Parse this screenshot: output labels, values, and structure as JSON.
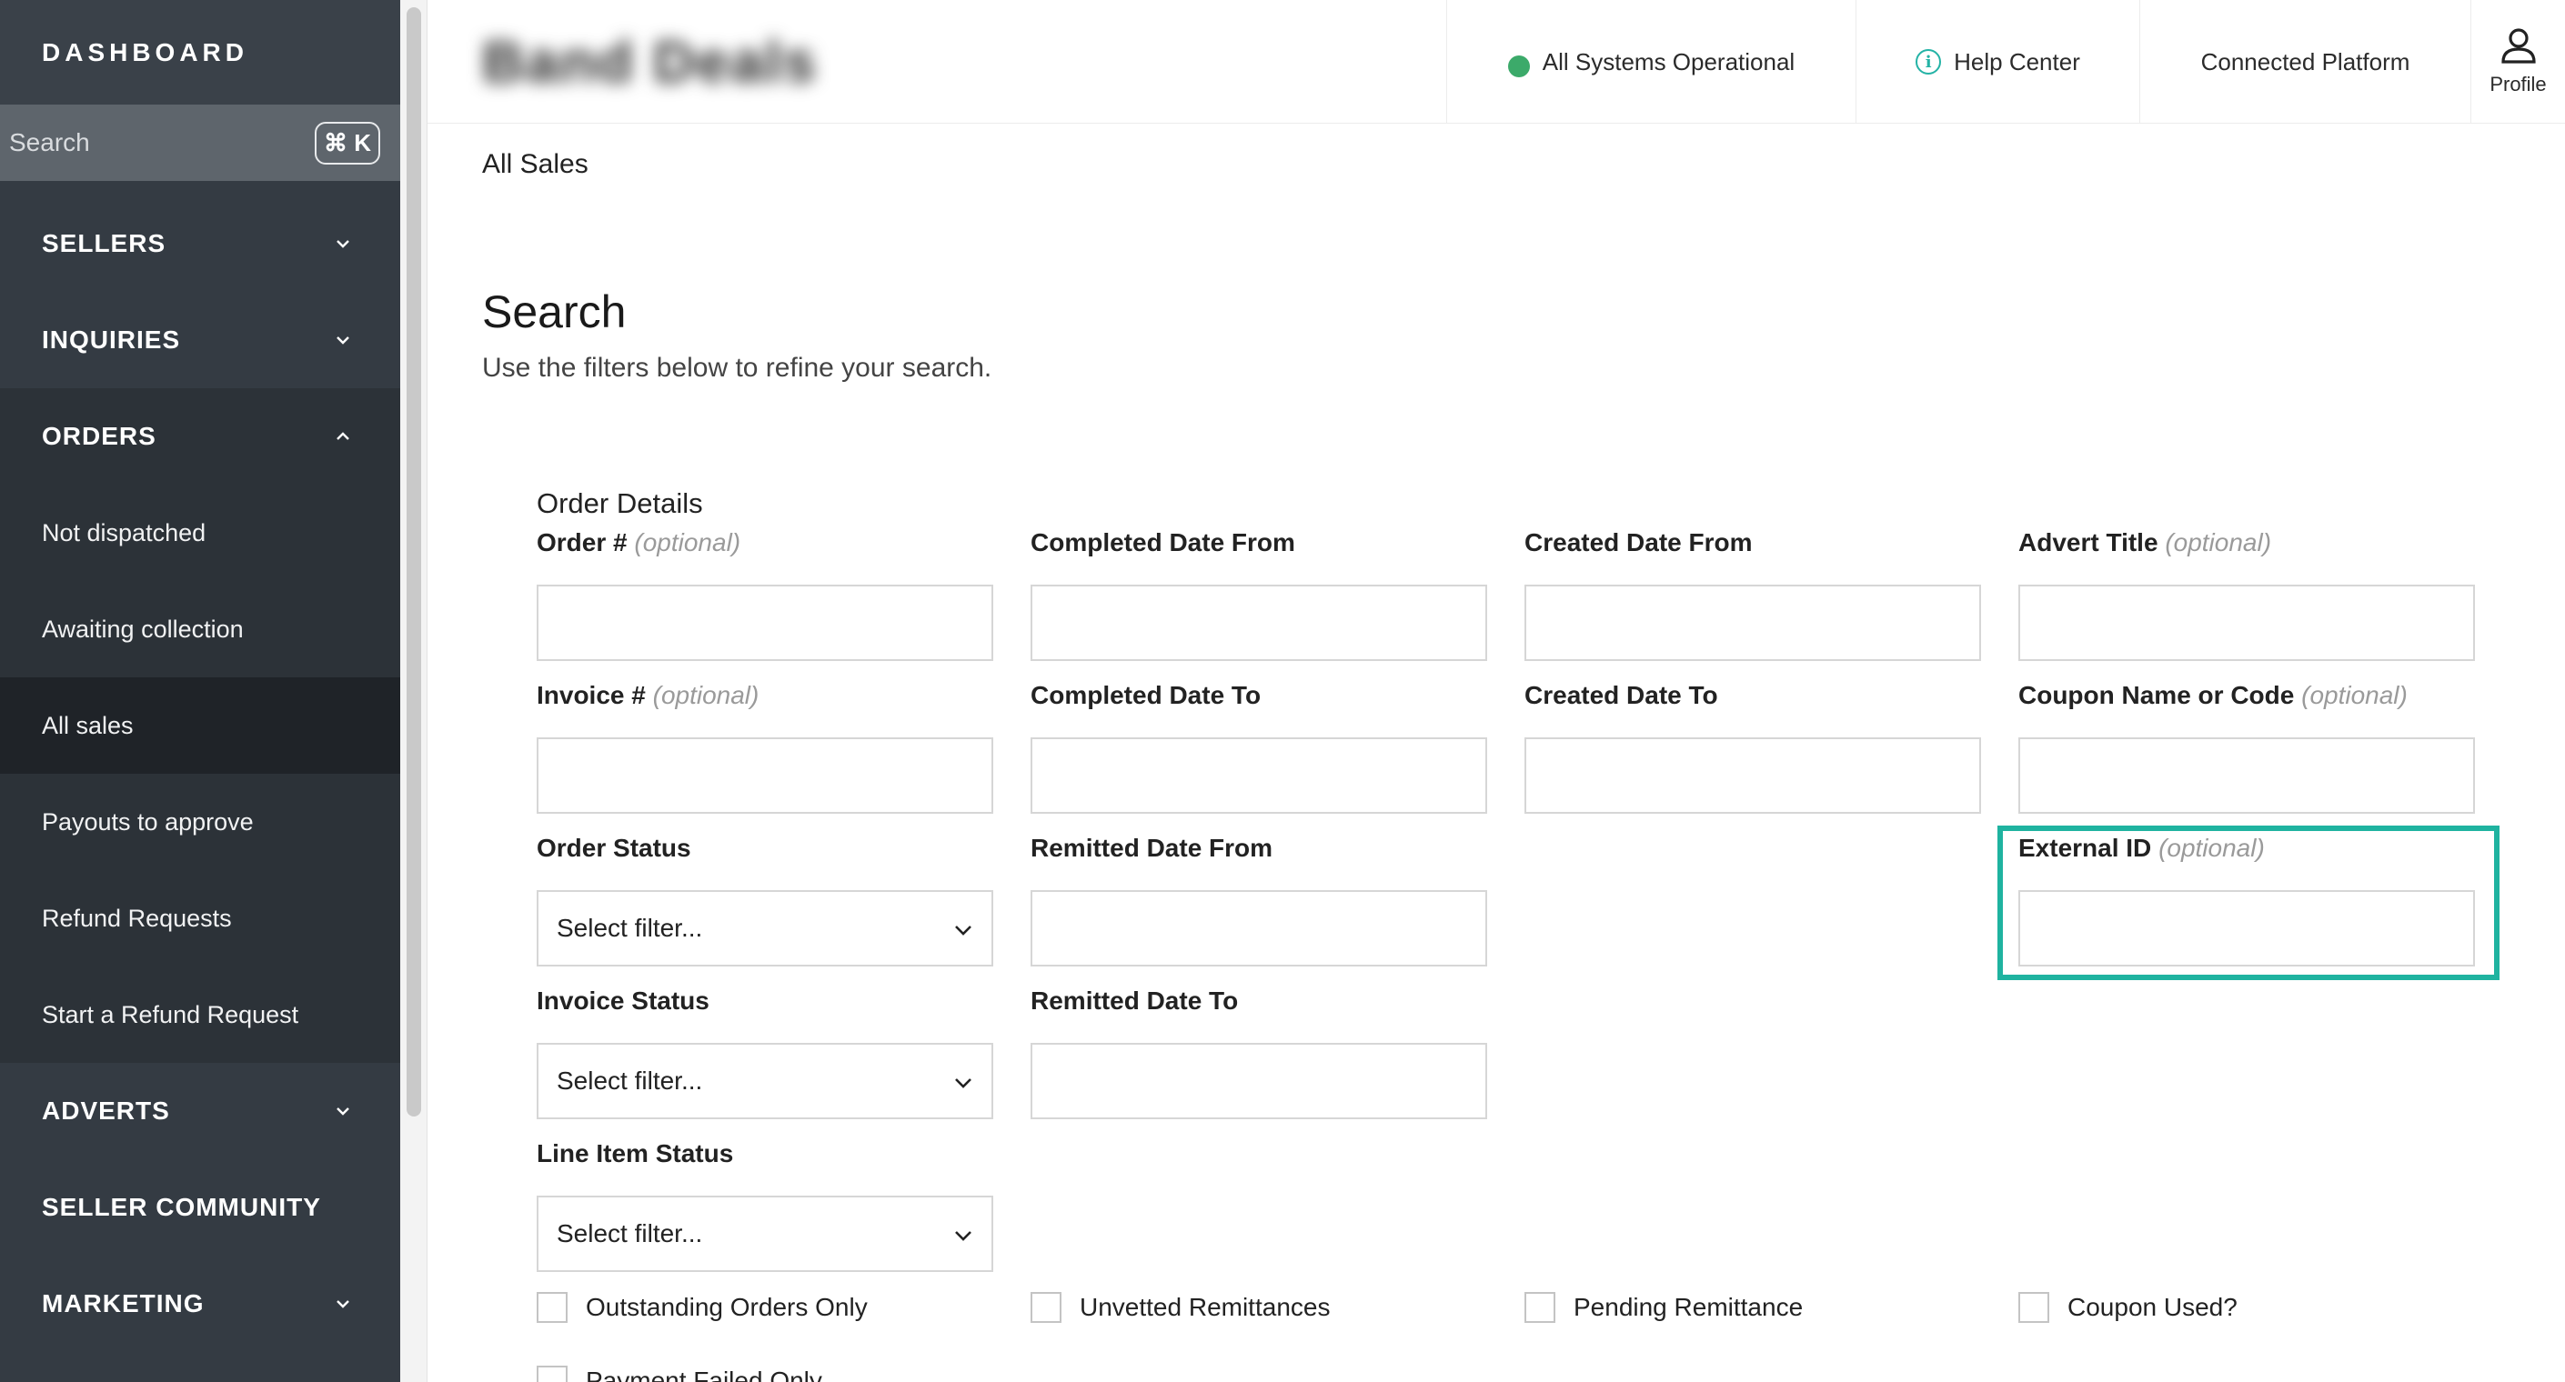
{
  "sidebar": {
    "title": "DASHBOARD",
    "search_placeholder": "Search",
    "search_shortcut": "⌘ K",
    "sections": [
      {
        "label": "SELLERS"
      },
      {
        "label": "INQUIRIES"
      },
      {
        "label": "ORDERS"
      }
    ],
    "orders_items": [
      {
        "label": "Not dispatched"
      },
      {
        "label": "Awaiting collection"
      },
      {
        "label": "All sales"
      },
      {
        "label": "Payouts to approve"
      },
      {
        "label": "Refund Requests"
      },
      {
        "label": "Start a Refund Request"
      }
    ],
    "lower_sections": [
      {
        "label": "ADVERTS"
      },
      {
        "label": "SELLER COMMUNITY"
      },
      {
        "label": "MARKETING"
      }
    ]
  },
  "topbar": {
    "brand": "Band Deals",
    "status": "All Systems Operational",
    "help": "Help Center",
    "connected": "Connected Platform",
    "profile": "Profile"
  },
  "main": {
    "breadcrumb": "All Sales",
    "title": "Search",
    "subtitle": "Use the filters below to refine your search.",
    "section_label": "Order Details",
    "optional": "(optional)",
    "fields": {
      "order_no": "Order #",
      "invoice_no": "Invoice #",
      "order_status": "Order Status",
      "invoice_status": "Invoice Status",
      "line_item_status": "Line Item Status",
      "completed_from": "Completed Date From",
      "completed_to": "Completed Date To",
      "remitted_from": "Remitted Date From",
      "remitted_to": "Remitted Date To",
      "created_from": "Created Date From",
      "created_to": "Created Date To",
      "advert_title": "Advert Title",
      "coupon": "Coupon Name or Code",
      "external_id": "External ID"
    },
    "select_placeholder": "Select filter...",
    "checkboxes": {
      "outstanding": "Outstanding Orders Only",
      "unvetted": "Unvetted Remittances",
      "pending": "Pending Remittance",
      "coupon_used": "Coupon Used?",
      "payment_failed": "Payment Failed Only"
    }
  }
}
